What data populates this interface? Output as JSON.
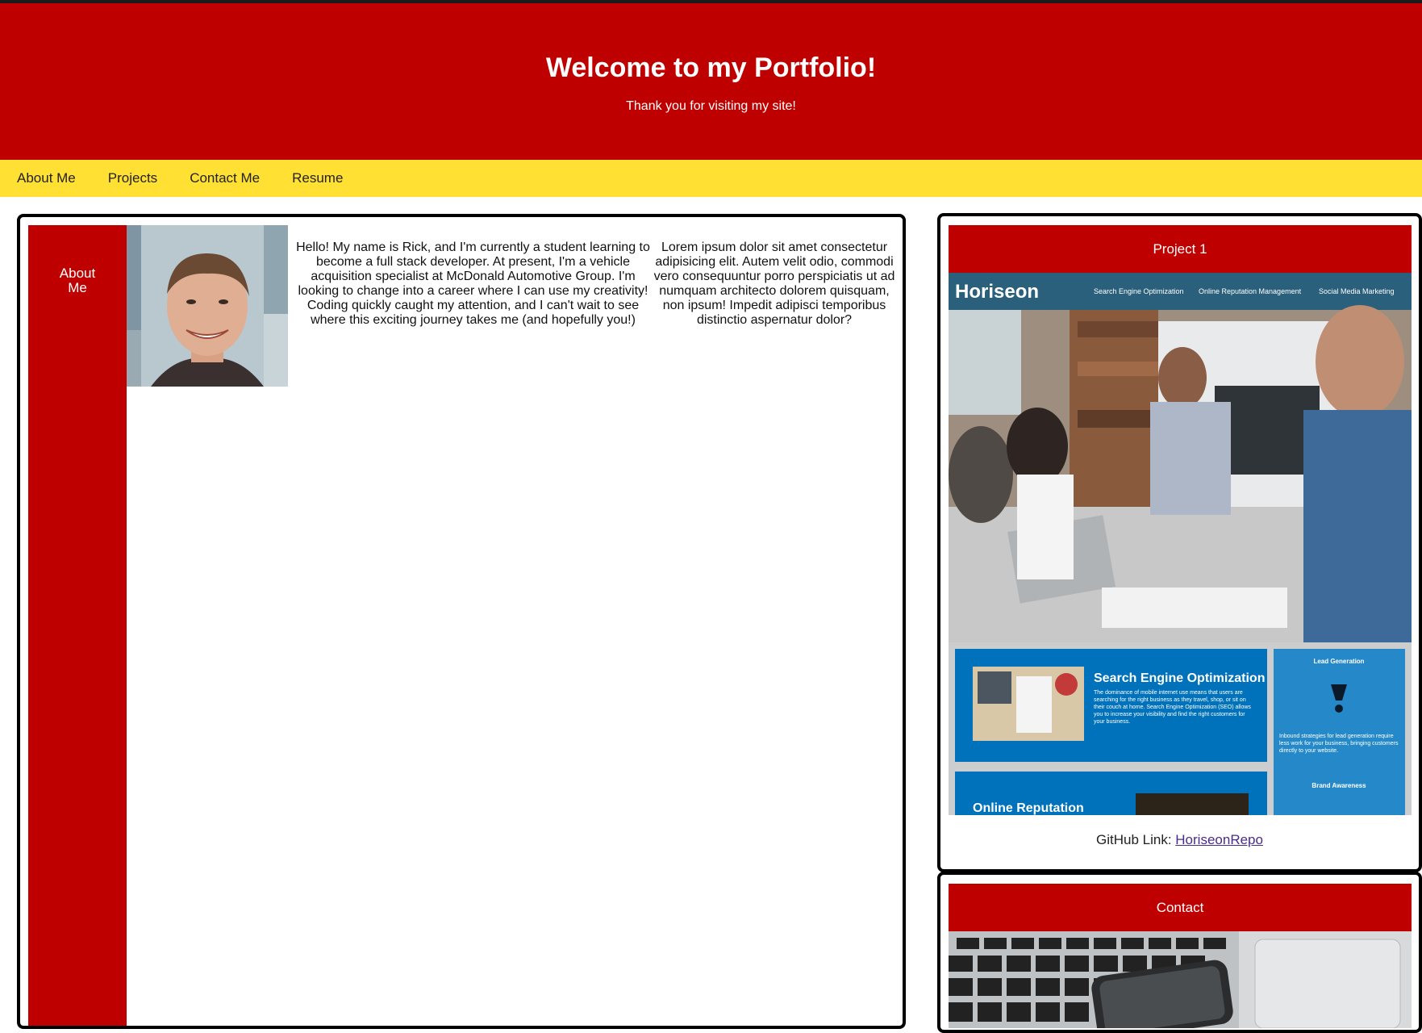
{
  "header": {
    "title": "Welcome to my Portfolio!",
    "subtitle": "Thank you for visiting my site!"
  },
  "nav": {
    "items": [
      {
        "label": "About Me"
      },
      {
        "label": "Projects"
      },
      {
        "label": "Contact Me"
      },
      {
        "label": "Resume"
      }
    ]
  },
  "about": {
    "side_label": "About Me",
    "bio": "Hello! My name is Rick, and I'm currently a student learning to become a full stack developer. At present, I'm a vehicle acquisition specialist at McDonald Automotive Group. I'm looking to change into a career where I can use my creativity! Coding quickly caught my attention, and I can't wait to see where this exciting journey takes me (and hopefully you!)",
    "lorem": "Lorem ipsum dolor sit amet consectetur adipisicing elit. Autem velit odio, commodi vero consequuntur porro perspiciatis ut ad numquam architecto dolorem quisquam, non ipsum! Impedit adipisci temporibus distinctio aspernatur dolor?"
  },
  "project1": {
    "title": "Project 1",
    "screenshot": {
      "brand": "Horiseon",
      "nav": [
        "Search Engine Optimization",
        "Online Reputation Management",
        "Social Media Marketing"
      ],
      "seo_title": "Search Engine Optimization",
      "seo_body": "The dominance of mobile internet use means that users are searching for the right business as they travel, shop, or sit on their couch at home. Search Engine Optimization (SEO) allows you to increase your visibility and find the right customers for your business.",
      "side_title": "Lead Generation",
      "side_body": "Inbound strategies for lead generation require less work for your business, bringing customers directly to your website.",
      "side_footer": "Brand Awareness",
      "next_title": "Online Reputation"
    },
    "github_prefix": "GitHub Link: ",
    "github_link": "HoriseonRepo"
  },
  "contact": {
    "title": "Contact"
  },
  "colors": {
    "header_red": "#bf0000",
    "nav_yellow": "#ffe033",
    "horiseon_blue": "#0072bb"
  }
}
